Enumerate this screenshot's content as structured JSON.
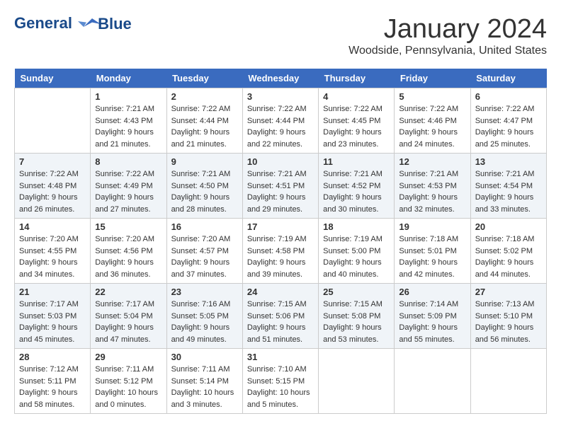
{
  "header": {
    "logo_line1": "General",
    "logo_line2": "Blue",
    "month_title": "January 2024",
    "location": "Woodside, Pennsylvania, United States"
  },
  "weekdays": [
    "Sunday",
    "Monday",
    "Tuesday",
    "Wednesday",
    "Thursday",
    "Friday",
    "Saturday"
  ],
  "weeks": [
    [
      {
        "day": "",
        "sunrise": "",
        "sunset": "",
        "daylight": ""
      },
      {
        "day": "1",
        "sunrise": "Sunrise: 7:21 AM",
        "sunset": "Sunset: 4:43 PM",
        "daylight": "Daylight: 9 hours and 21 minutes."
      },
      {
        "day": "2",
        "sunrise": "Sunrise: 7:22 AM",
        "sunset": "Sunset: 4:44 PM",
        "daylight": "Daylight: 9 hours and 21 minutes."
      },
      {
        "day": "3",
        "sunrise": "Sunrise: 7:22 AM",
        "sunset": "Sunset: 4:44 PM",
        "daylight": "Daylight: 9 hours and 22 minutes."
      },
      {
        "day": "4",
        "sunrise": "Sunrise: 7:22 AM",
        "sunset": "Sunset: 4:45 PM",
        "daylight": "Daylight: 9 hours and 23 minutes."
      },
      {
        "day": "5",
        "sunrise": "Sunrise: 7:22 AM",
        "sunset": "Sunset: 4:46 PM",
        "daylight": "Daylight: 9 hours and 24 minutes."
      },
      {
        "day": "6",
        "sunrise": "Sunrise: 7:22 AM",
        "sunset": "Sunset: 4:47 PM",
        "daylight": "Daylight: 9 hours and 25 minutes."
      }
    ],
    [
      {
        "day": "7",
        "sunrise": "Sunrise: 7:22 AM",
        "sunset": "Sunset: 4:48 PM",
        "daylight": "Daylight: 9 hours and 26 minutes."
      },
      {
        "day": "8",
        "sunrise": "Sunrise: 7:22 AM",
        "sunset": "Sunset: 4:49 PM",
        "daylight": "Daylight: 9 hours and 27 minutes."
      },
      {
        "day": "9",
        "sunrise": "Sunrise: 7:21 AM",
        "sunset": "Sunset: 4:50 PM",
        "daylight": "Daylight: 9 hours and 28 minutes."
      },
      {
        "day": "10",
        "sunrise": "Sunrise: 7:21 AM",
        "sunset": "Sunset: 4:51 PM",
        "daylight": "Daylight: 9 hours and 29 minutes."
      },
      {
        "day": "11",
        "sunrise": "Sunrise: 7:21 AM",
        "sunset": "Sunset: 4:52 PM",
        "daylight": "Daylight: 9 hours and 30 minutes."
      },
      {
        "day": "12",
        "sunrise": "Sunrise: 7:21 AM",
        "sunset": "Sunset: 4:53 PM",
        "daylight": "Daylight: 9 hours and 32 minutes."
      },
      {
        "day": "13",
        "sunrise": "Sunrise: 7:21 AM",
        "sunset": "Sunset: 4:54 PM",
        "daylight": "Daylight: 9 hours and 33 minutes."
      }
    ],
    [
      {
        "day": "14",
        "sunrise": "Sunrise: 7:20 AM",
        "sunset": "Sunset: 4:55 PM",
        "daylight": "Daylight: 9 hours and 34 minutes."
      },
      {
        "day": "15",
        "sunrise": "Sunrise: 7:20 AM",
        "sunset": "Sunset: 4:56 PM",
        "daylight": "Daylight: 9 hours and 36 minutes."
      },
      {
        "day": "16",
        "sunrise": "Sunrise: 7:20 AM",
        "sunset": "Sunset: 4:57 PM",
        "daylight": "Daylight: 9 hours and 37 minutes."
      },
      {
        "day": "17",
        "sunrise": "Sunrise: 7:19 AM",
        "sunset": "Sunset: 4:58 PM",
        "daylight": "Daylight: 9 hours and 39 minutes."
      },
      {
        "day": "18",
        "sunrise": "Sunrise: 7:19 AM",
        "sunset": "Sunset: 5:00 PM",
        "daylight": "Daylight: 9 hours and 40 minutes."
      },
      {
        "day": "19",
        "sunrise": "Sunrise: 7:18 AM",
        "sunset": "Sunset: 5:01 PM",
        "daylight": "Daylight: 9 hours and 42 minutes."
      },
      {
        "day": "20",
        "sunrise": "Sunrise: 7:18 AM",
        "sunset": "Sunset: 5:02 PM",
        "daylight": "Daylight: 9 hours and 44 minutes."
      }
    ],
    [
      {
        "day": "21",
        "sunrise": "Sunrise: 7:17 AM",
        "sunset": "Sunset: 5:03 PM",
        "daylight": "Daylight: 9 hours and 45 minutes."
      },
      {
        "day": "22",
        "sunrise": "Sunrise: 7:17 AM",
        "sunset": "Sunset: 5:04 PM",
        "daylight": "Daylight: 9 hours and 47 minutes."
      },
      {
        "day": "23",
        "sunrise": "Sunrise: 7:16 AM",
        "sunset": "Sunset: 5:05 PM",
        "daylight": "Daylight: 9 hours and 49 minutes."
      },
      {
        "day": "24",
        "sunrise": "Sunrise: 7:15 AM",
        "sunset": "Sunset: 5:06 PM",
        "daylight": "Daylight: 9 hours and 51 minutes."
      },
      {
        "day": "25",
        "sunrise": "Sunrise: 7:15 AM",
        "sunset": "Sunset: 5:08 PM",
        "daylight": "Daylight: 9 hours and 53 minutes."
      },
      {
        "day": "26",
        "sunrise": "Sunrise: 7:14 AM",
        "sunset": "Sunset: 5:09 PM",
        "daylight": "Daylight: 9 hours and 55 minutes."
      },
      {
        "day": "27",
        "sunrise": "Sunrise: 7:13 AM",
        "sunset": "Sunset: 5:10 PM",
        "daylight": "Daylight: 9 hours and 56 minutes."
      }
    ],
    [
      {
        "day": "28",
        "sunrise": "Sunrise: 7:12 AM",
        "sunset": "Sunset: 5:11 PM",
        "daylight": "Daylight: 9 hours and 58 minutes."
      },
      {
        "day": "29",
        "sunrise": "Sunrise: 7:11 AM",
        "sunset": "Sunset: 5:12 PM",
        "daylight": "Daylight: 10 hours and 0 minutes."
      },
      {
        "day": "30",
        "sunrise": "Sunrise: 7:11 AM",
        "sunset": "Sunset: 5:14 PM",
        "daylight": "Daylight: 10 hours and 3 minutes."
      },
      {
        "day": "31",
        "sunrise": "Sunrise: 7:10 AM",
        "sunset": "Sunset: 5:15 PM",
        "daylight": "Daylight: 10 hours and 5 minutes."
      },
      {
        "day": "",
        "sunrise": "",
        "sunset": "",
        "daylight": ""
      },
      {
        "day": "",
        "sunrise": "",
        "sunset": "",
        "daylight": ""
      },
      {
        "day": "",
        "sunrise": "",
        "sunset": "",
        "daylight": ""
      }
    ]
  ]
}
